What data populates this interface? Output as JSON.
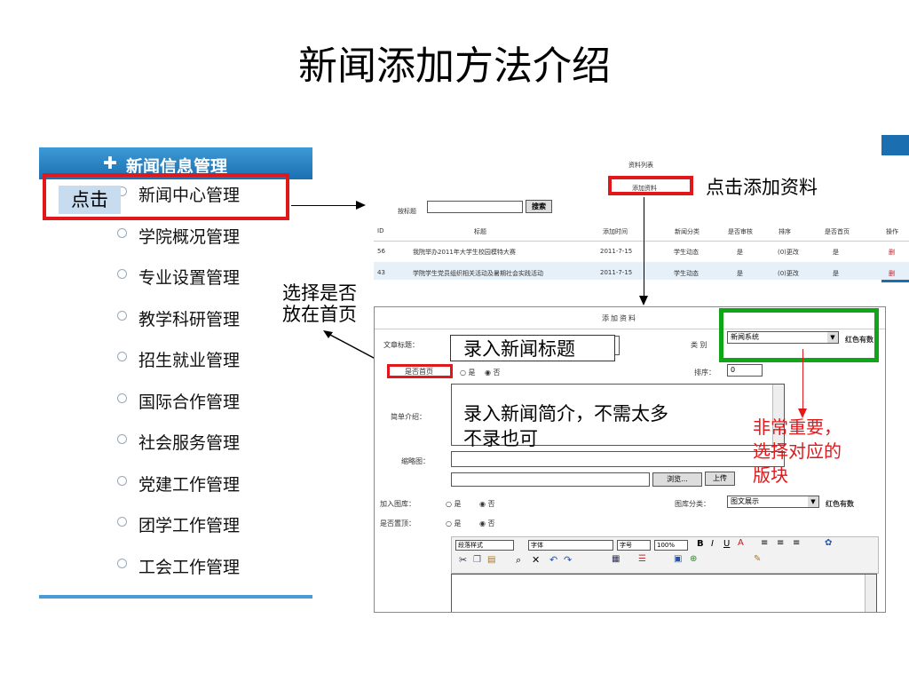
{
  "slide": {
    "title": "新闻添加方法介绍"
  },
  "nav": {
    "header": "新闻信息管理",
    "items": [
      "新闻中心管理",
      "学院概况管理",
      "专业设置管理",
      "教学科研管理",
      "招生就业管理",
      "国际合作管理",
      "社会服务管理",
      "党建工作管理",
      "团学工作管理",
      "工会工作管理"
    ]
  },
  "annotations": {
    "click": "点击",
    "click_add": "点击添加资料",
    "select_home": "选择是否放在首页",
    "very_important": [
      "非常重要，",
      "选择对应的",
      "版块"
    ],
    "input_title": "录入新闻标题",
    "input_intro": [
      "录入新闻简介，不需太多",
      "不录也可"
    ]
  },
  "list": {
    "link_list": "资料列表",
    "link_add": "添加资料",
    "search_label": "按标题",
    "search_btn": "搜索",
    "headers": [
      "ID",
      "标题",
      "添加时间",
      "新闻分类",
      "是否审核",
      "排序",
      "是否首页",
      "操作"
    ],
    "rows": [
      [
        "56",
        "我院举办2011年大学生校园模特大赛",
        "2011-7-15",
        "学生动态",
        "是",
        "(0)更改",
        "是",
        "删"
      ],
      [
        "43",
        "学院学生党员组织相关活动及暑期社会实践活动",
        "2011-7-15",
        "学生动态",
        "是",
        "(0)更改",
        "是",
        "删"
      ]
    ]
  },
  "form": {
    "header": "添加资料",
    "label_title": "文章标题：",
    "label_category": "类 别",
    "category_value": "新闻系统",
    "category_note": "红色有数",
    "label_home": "是否首页",
    "opt_yes": "是",
    "opt_no": "否",
    "label_order": "排序：",
    "order_value": "0",
    "label_intro": "简单介绍：",
    "label_thumb": "缩略图：",
    "browse_btn": "浏览...",
    "upload_btn": "上传",
    "label_gallery": "加入图库：",
    "label_gallery_cat": "图库分类：",
    "gallery_cat_value": "图文展示",
    "gallery_note": "红色有数",
    "label_top": "是否置顶：",
    "toolbar_selects": [
      "段落样式",
      "字体",
      "字号",
      "100%"
    ]
  }
}
